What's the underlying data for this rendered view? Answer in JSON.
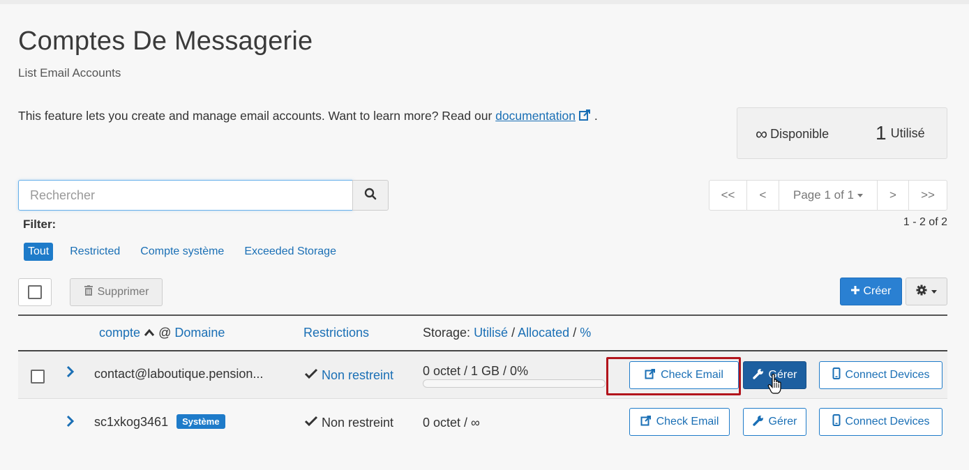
{
  "header": {
    "title": "Comptes De Messagerie",
    "subtitle": "List Email Accounts"
  },
  "intro": {
    "text": "This feature lets you create and manage email accounts. Want to learn more? Read our ",
    "link_label": "documentation",
    "suffix": "."
  },
  "stats": {
    "available_value": "∞",
    "available_label": "Disponible",
    "used_value": "1",
    "used_label": "Utilisé"
  },
  "search": {
    "placeholder": "Rechercher",
    "value": ""
  },
  "pager": {
    "first": "<<",
    "prev": "<",
    "page_label": "Page 1 of 1",
    "next": ">",
    "last": ">>"
  },
  "filter": {
    "label": "Filter:",
    "range": "1 - 2 of 2",
    "options": [
      "Tout",
      "Restricted",
      "Compte système",
      "Exceeded Storage"
    ],
    "active": "Tout"
  },
  "toolbar": {
    "delete_label": "Supprimer",
    "create_label": "Créer"
  },
  "table": {
    "columns": {
      "account": "compte",
      "at": "@",
      "domain": "Domaine",
      "restrictions": "Restrictions",
      "storage_prefix": "Storage:",
      "storage_used": "Utilisé",
      "storage_sep": "/",
      "storage_allocated": "Allocated",
      "storage_pct": "%"
    },
    "rows": [
      {
        "account": "contact@laboutique.pension...",
        "badge": "",
        "restriction": "Non restreint",
        "storage": "0 octet / 1 GB / 0%",
        "storage_fraction": 0,
        "check_email": "Check Email",
        "manage": "Gérer",
        "connect": "Connect Devices"
      },
      {
        "account": "sc1xkog3461",
        "badge": "Système",
        "restriction": "Non restreint",
        "storage": "0 octet / ∞",
        "check_email": "Check Email",
        "manage": "Gérer",
        "connect": "Connect Devices"
      }
    ]
  },
  "colors": {
    "accent": "#1e7bc9",
    "link": "#1a6fb5",
    "manage_active": "#1d5fa0",
    "highlight": "#b2141c"
  }
}
